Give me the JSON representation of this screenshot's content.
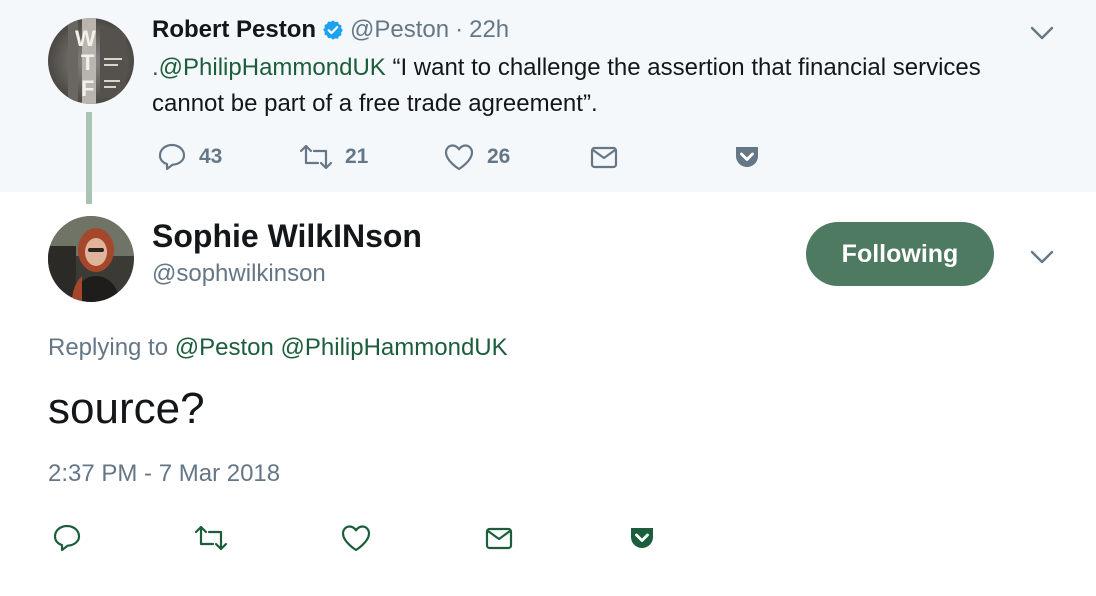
{
  "parent_tweet": {
    "author_name": "Robert Peston",
    "author_handle": "@Peston",
    "separator": "·",
    "time": "22h",
    "text_mention": ".@PhilipHammondUK",
    "text_body": " “I want to challenge the assertion that financial services cannot be part of a free trade agreement”.",
    "avatar_icon": "wtf-book-cover-avatar",
    "counts": {
      "replies": "43",
      "retweets": "21",
      "likes": "26"
    }
  },
  "tweet": {
    "author_name": "Sophie WilkINson",
    "author_handle": "@sophwilkinson",
    "follow_label": "Following",
    "replying_prefix": "Replying to",
    "replying_to": [
      "@Peston",
      "@PhilipHammondUK"
    ],
    "text": "source?",
    "timestamp": "2:37 PM - 7 Mar 2018",
    "avatar_icon": "woman-red-hair-avatar"
  },
  "colors": {
    "accent_green": "#1c5e3b",
    "button_green": "#4f7a62",
    "muted_gray": "#657786",
    "parent_bg": "#f5f8fa",
    "thread_line": "#a7c4b5",
    "verified_blue": "#1da1f2"
  },
  "icons": [
    "reply-icon",
    "retweet-icon",
    "like-icon",
    "dm-icon",
    "pocket-icon",
    "chevron-down-icon",
    "verified-badge-icon"
  ]
}
